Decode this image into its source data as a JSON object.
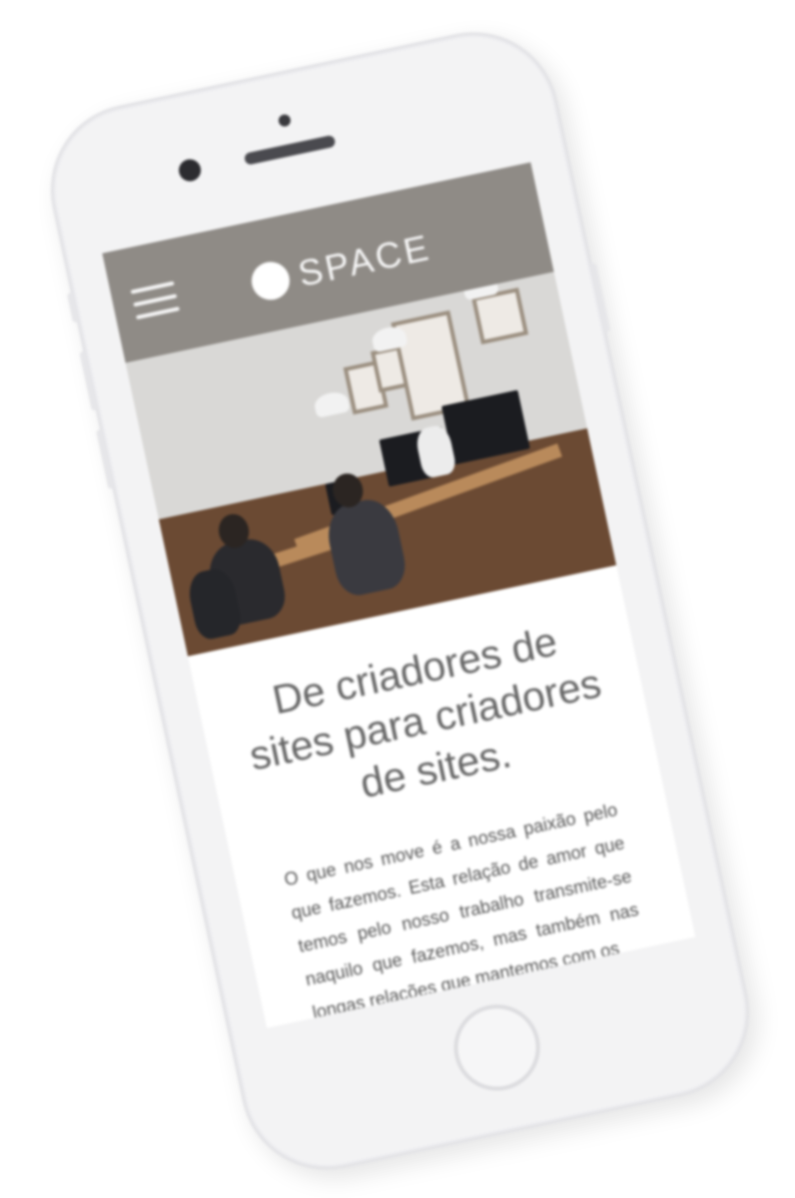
{
  "site": {
    "logo_text": "SPACE",
    "headline": "De criadores de sites para criadores de sites.",
    "body_text": "O que nos move é a nossa paixão pelo que fazemos. Esta relação de amor que temos pelo nosso trabalho transmite-se naquilo que fazemos, mas também nas longas relações que mantemos com os"
  },
  "icons": {
    "menu": "hamburger-menu-icon",
    "logo_mark": "logo-circle-icon"
  },
  "colors": {
    "header_bar": "#8f8b86",
    "headline_text": "#666666",
    "body_text": "#555555",
    "phone_body": "#f3f3f4"
  }
}
